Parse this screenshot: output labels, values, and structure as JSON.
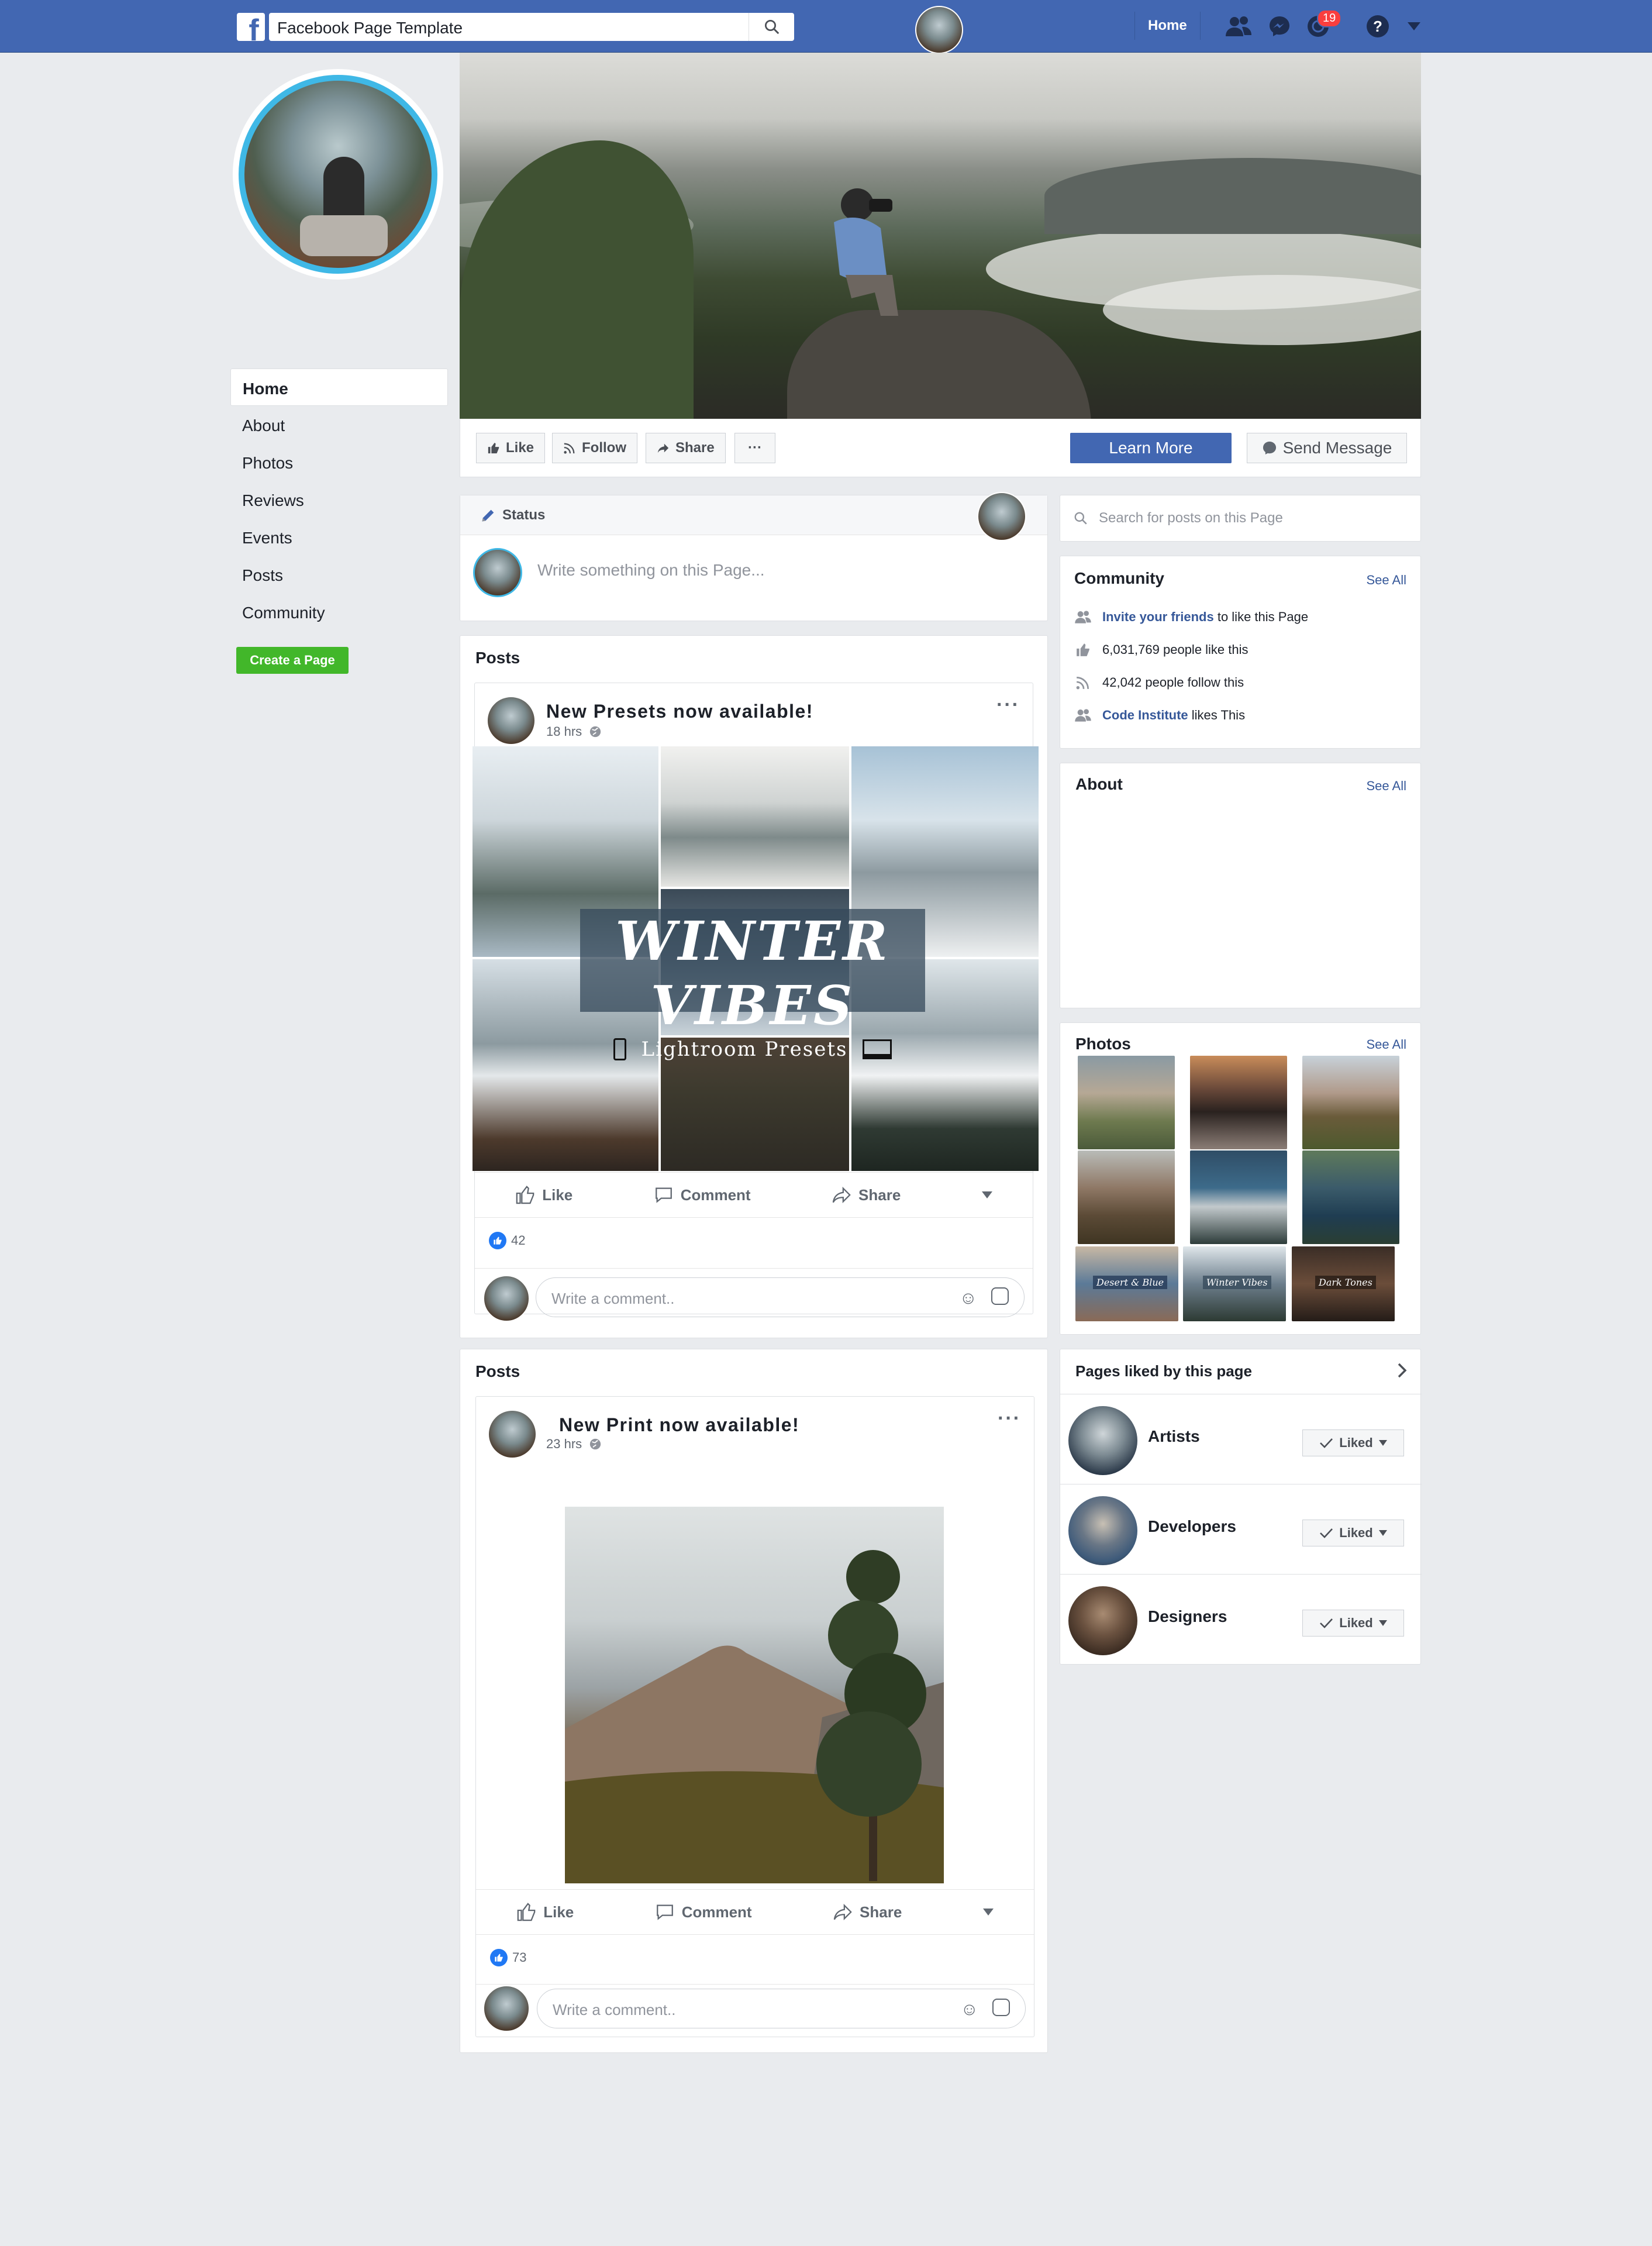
{
  "topbar": {
    "search_value": "Facebook Page Template",
    "home_label": "Home",
    "notification_count": "19",
    "icons": [
      "facebook-logo-icon",
      "search-icon",
      "friends-icon",
      "messenger-icon",
      "notifications-icon",
      "help-icon",
      "caret-down-icon"
    ]
  },
  "left_nav": {
    "items": [
      "Home",
      "About",
      "Photos",
      "Reviews",
      "Events",
      "Posts",
      "Community"
    ],
    "active": "Home",
    "create_page_label": "Create a Page"
  },
  "action_bar": {
    "like_label": "Like",
    "follow_label": "Follow",
    "share_label": "Share",
    "more_label": "···",
    "learn_more_label": "Learn More",
    "send_message_label": "Send Message"
  },
  "status": {
    "tab_label": "Status",
    "placeholder": "Write something on this Page..."
  },
  "posts": [
    {
      "section_label": "Posts",
      "title": "New Presets now available!",
      "time": "18 hrs",
      "image_text_main": "Winter Vibes",
      "image_text_sub": "Lightroom Presets",
      "like_label": "Like",
      "comment_label": "Comment",
      "share_label": "Share",
      "likes": "42",
      "comment_placeholder": "Write a comment.."
    },
    {
      "section_label": "Posts",
      "title": "New Print now available!",
      "time": "23 hrs",
      "like_label": "Like",
      "comment_label": "Comment",
      "share_label": "Share",
      "likes": "73",
      "comment_placeholder": "Write a comment.."
    }
  ],
  "right": {
    "search_placeholder": "Search for posts on this Page",
    "community": {
      "title": "Community",
      "see_all": "See All",
      "invite_link": "Invite your friends",
      "invite_rest": " to like this Page",
      "likes_text": "6,031,769 people like this",
      "follows_text": "42,042 people follow this",
      "ci_link": "Code Institute",
      "ci_rest": " likes This"
    },
    "about": {
      "title": "About",
      "see_all": "See All"
    },
    "photos": {
      "title": "Photos",
      "see_all": "See All",
      "caption_1": "Desert & Blue",
      "caption_2": "Winter Vibes",
      "caption_3": "Dark Tones"
    },
    "pages_liked": {
      "title": "Pages liked by this page",
      "liked_label": "Liked",
      "items": [
        "Artists",
        "Developers",
        "Designers"
      ]
    }
  },
  "colors": {
    "brand_blue": "#4267b2",
    "link_blue": "#365899",
    "create_green": "#42b72a",
    "badge_red": "#fa3e3e",
    "page_bg": "#e9ebee"
  }
}
